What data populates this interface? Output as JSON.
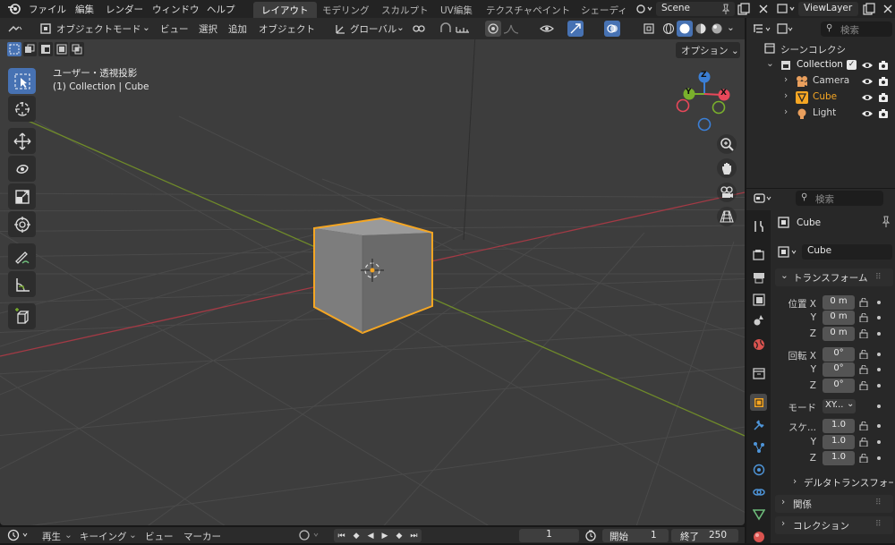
{
  "menubar": {
    "items": [
      "ファイル",
      "編集",
      "レンダー",
      "ウィンドウ",
      "ヘルプ"
    ],
    "workspaces": [
      "レイアウト",
      "モデリング",
      "スカルプト",
      "UV編集",
      "テクスチャペイント",
      "シェーディ"
    ],
    "active_workspace": "レイアウト",
    "scene": "Scene",
    "view_layer": "ViewLayer"
  },
  "viewport_header": {
    "mode": "オブジェクトモード",
    "menus": [
      "ビュー",
      "選択",
      "追加",
      "オブジェクト"
    ],
    "orientation": "グローバル",
    "options": "オプション"
  },
  "viewport": {
    "view_name": "ユーザー・透視投影",
    "collection_info": "(1) Collection | Cube"
  },
  "gizmo": {
    "x": "X",
    "y": "Y",
    "z": "Z"
  },
  "outliner": {
    "search_placeholder": "検索",
    "root": "シーンコレクシ",
    "collection": "Collection",
    "items": [
      "Camera",
      "Cube",
      "Light"
    ]
  },
  "properties": {
    "search_placeholder": "検索",
    "object_name": "Cube",
    "data_name": "Cube",
    "transform_header": "トランスフォーム",
    "location_label": "位置 X",
    "location": [
      "0 m",
      "0 m",
      "0 m"
    ],
    "rotation_label": "回転 X",
    "rotation": [
      "0°",
      "0°",
      "0°"
    ],
    "mode_label": "モード",
    "mode_value": "XY...",
    "scale_label": "スケ...",
    "scale": [
      "1.0",
      "1.0",
      "1.0"
    ],
    "axis_y": "Y",
    "axis_z": "Z",
    "delta_transform": "デルタトランスフォー",
    "relations": "関係",
    "collections": "コレクション"
  },
  "timeline": {
    "playback": "再生",
    "keying": "キーイング",
    "view": "ビュー",
    "marker": "マーカー",
    "current_frame": "1",
    "start_label": "開始",
    "start": "1",
    "end_label": "終了",
    "end": "250"
  },
  "colors": {
    "accent": "#4772b3",
    "selection_orange": "#f5a623",
    "axis_x": "#e8485a",
    "axis_y": "#7ab02c",
    "axis_z": "#3b7fd6"
  }
}
